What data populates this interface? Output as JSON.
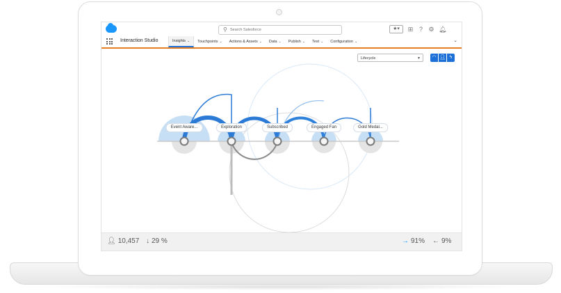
{
  "header": {
    "search_placeholder": "Search Salesforce",
    "icons": [
      "favorites-star-icon",
      "add-icon",
      "help-icon",
      "gear-icon",
      "bell-icon"
    ]
  },
  "nav": {
    "app_name": "Interaction Studio",
    "tabs": [
      {
        "label": "Insights",
        "active": true
      },
      {
        "label": "Touchpoints",
        "active": false
      },
      {
        "label": "Actions & Assets",
        "active": false
      },
      {
        "label": "Data",
        "active": false
      },
      {
        "label": "Publish",
        "active": false
      },
      {
        "label": "Test",
        "active": false
      },
      {
        "label": "Configuration",
        "active": false
      }
    ]
  },
  "toolbar": {
    "selected_view": "Lifecycle"
  },
  "lifecycle": {
    "stages": [
      "Event Aware...",
      "Exploration",
      "Subscribed",
      "Engaged Fan",
      "Gold Medal..."
    ]
  },
  "footer": {
    "users": "10,457",
    "drop": "29 %",
    "forward": "91%",
    "back": "9%"
  },
  "colors": {
    "accent": "#1b6fd6",
    "brand": "#1b96ff",
    "nav_underline": "#e67e22"
  }
}
